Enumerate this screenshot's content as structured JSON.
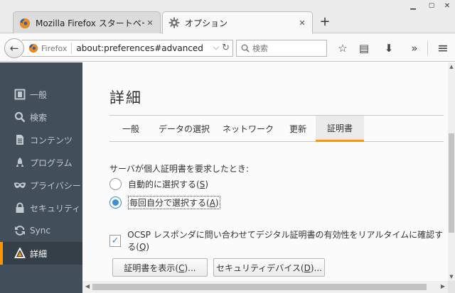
{
  "window": {
    "minimize": "▁",
    "close": "✕"
  },
  "tabs": [
    {
      "title": "Mozilla Firefox スタートページ",
      "icon": "firefox-icon"
    },
    {
      "title": "オプション",
      "icon": "gear-icon"
    }
  ],
  "tab_close": "✕",
  "new_tab": "+",
  "nav": {
    "back": "←",
    "identity": "Firefox",
    "url": "about:preferences#advanced",
    "dropdown": "⌵",
    "reload": "↻",
    "search_placeholder": "検索",
    "bookmark": "☆",
    "reading_list": "▤",
    "download": "⬇",
    "overflow": "»",
    "menu": "≡"
  },
  "sidebar": {
    "items": [
      {
        "label": "一般",
        "icon": "general-icon",
        "glyph": "⊡"
      },
      {
        "label": "検索",
        "icon": "search-icon",
        "glyph": "⚲"
      },
      {
        "label": "コンテンツ",
        "icon": "content-icon",
        "glyph": "▤"
      },
      {
        "label": "プログラム",
        "icon": "applications-icon",
        "glyph": "▲"
      },
      {
        "label": "プライバシー",
        "icon": "privacy-mask-icon",
        "glyph": "∞"
      },
      {
        "label": "セキュリティ",
        "icon": "security-lock-icon",
        "glyph": "🔒"
      },
      {
        "label": "Sync",
        "icon": "sync-icon",
        "glyph": "⟳"
      },
      {
        "label": "詳細",
        "icon": "advanced-icon",
        "glyph": "⚠"
      }
    ],
    "selected_index": 7
  },
  "main": {
    "heading": "詳細",
    "tabs": [
      "一般",
      "データの選択",
      "ネットワーク",
      "更新",
      "証明書"
    ],
    "active_tab": "証明書",
    "prompt": "サーバが個人証明書を要求したとき:",
    "radio_auto": {
      "label": "自動的に選択する(",
      "key": "S",
      "end": ")",
      "checked": false
    },
    "radio_ask": {
      "label": "毎回自分で選択する(",
      "key": "A",
      "end": ")",
      "checked": true
    },
    "ocsp": {
      "label": "OCSP レスポンダに問い合わせてデジタル証明書の有効性をリアルタイムに確認する(",
      "key": "Q",
      "end": ")",
      "checked": true
    },
    "view_certs": {
      "label": "証明書を表示(",
      "key": "C",
      "end": ")..."
    },
    "security_devices": {
      "label": "セキュリティデバイス(",
      "key": "D",
      "end": ")..."
    }
  },
  "colors": {
    "accent": "#ff9500",
    "sidebar": "#424f5a",
    "sidebar_selected": "#343f48",
    "radio_blue": "#3a8fd8"
  }
}
